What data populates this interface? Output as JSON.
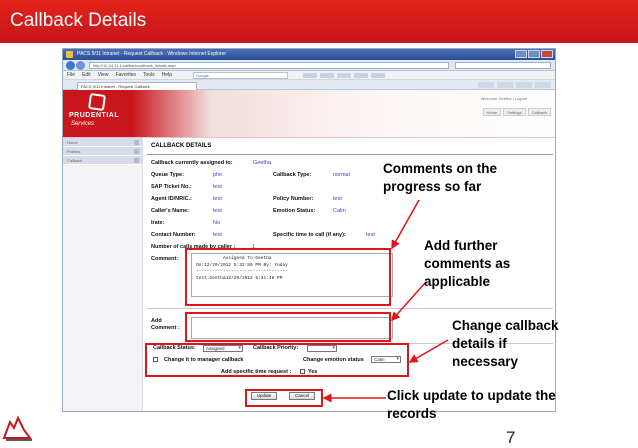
{
  "slide": {
    "title": "Callback Details",
    "page_number": "7"
  },
  "browser": {
    "window_title": "PACS 9/11 Intranet - Request Callback - Windows Internet Explorer",
    "address": "http://10.24.11.1/callback/callback_details.aspx",
    "menu_items": [
      "File",
      "Edit",
      "View",
      "Favorites",
      "Tools",
      "Help"
    ],
    "search_provider": "Google",
    "tab_label": "PACS 9/11 Intranet - Request Callback"
  },
  "app": {
    "logo_text": "PRUDENTIAL",
    "logo_sub": "Services",
    "welcome": "Welcome Geetha | Logout",
    "top_links": [
      "Home",
      "Settings",
      "Callback"
    ],
    "nav_items": [
      "Home",
      "Profiles",
      "Callback"
    ]
  },
  "form": {
    "section_title": "CALLBACK DETAILS",
    "assigned_label": "Callback currently assigned to:",
    "assigned_value": "Geetha",
    "queue_type_label": "Queue Type:",
    "queue_type_value": "phe",
    "callback_type_label": "Callback Type:",
    "callback_type_value": "normal",
    "sap_label": "SAP Ticket No.:",
    "sap_value": "test",
    "agent_label": "Agent ID/NRIC.:",
    "agent_value": "test",
    "policy_label": "Policy Number:",
    "policy_value": "test",
    "caller_label": "Caller's Name:",
    "caller_value": "test",
    "emotion_label": "Emotion Status:",
    "emotion_value": "Calm",
    "irate_label": "Irate:",
    "irate_value": "No",
    "contact_label": "Contact Number:",
    "contact_value": "test",
    "specific_label": "Specific time to call (if any):",
    "specific_value": "test",
    "calls_label": "Number of calls made by caller :",
    "calls_value": "1",
    "comment_label": "Comment:",
    "comment_lines": [
      "          Assigned To:Geetha",
      "On:12/20/2012 5:32:50 PM By: Yuday",
      "----------------------------------",
      "test:Geetha12/20/2012 5:31:46 PM"
    ],
    "add_label": "Add",
    "add_label2": "Comment :",
    "status_label": "Callback Status:",
    "status_value": "Assigned",
    "priority_label": "Callback Priority:",
    "priority_value": "",
    "manager_label": "Change it to manager callback",
    "change_emotion_label": "Change emotion status",
    "change_emotion_value": "Calm",
    "specific_req_label": "Add specific time request :",
    "yes_label": "Yes",
    "update_button": "Update",
    "cancel_button": "Cancel"
  },
  "callouts": {
    "comments": [
      "Comments on the",
      "progress so far"
    ],
    "further": [
      "Add further",
      "comments as",
      "applicable"
    ],
    "change": [
      "Change callback",
      "details if",
      "necessary"
    ],
    "update": [
      "Click update to update the",
      "records"
    ]
  },
  "colors": {
    "header_red": "#c8161c",
    "highlight_red": "#e0141b",
    "value_blue": "#3a43c8"
  }
}
